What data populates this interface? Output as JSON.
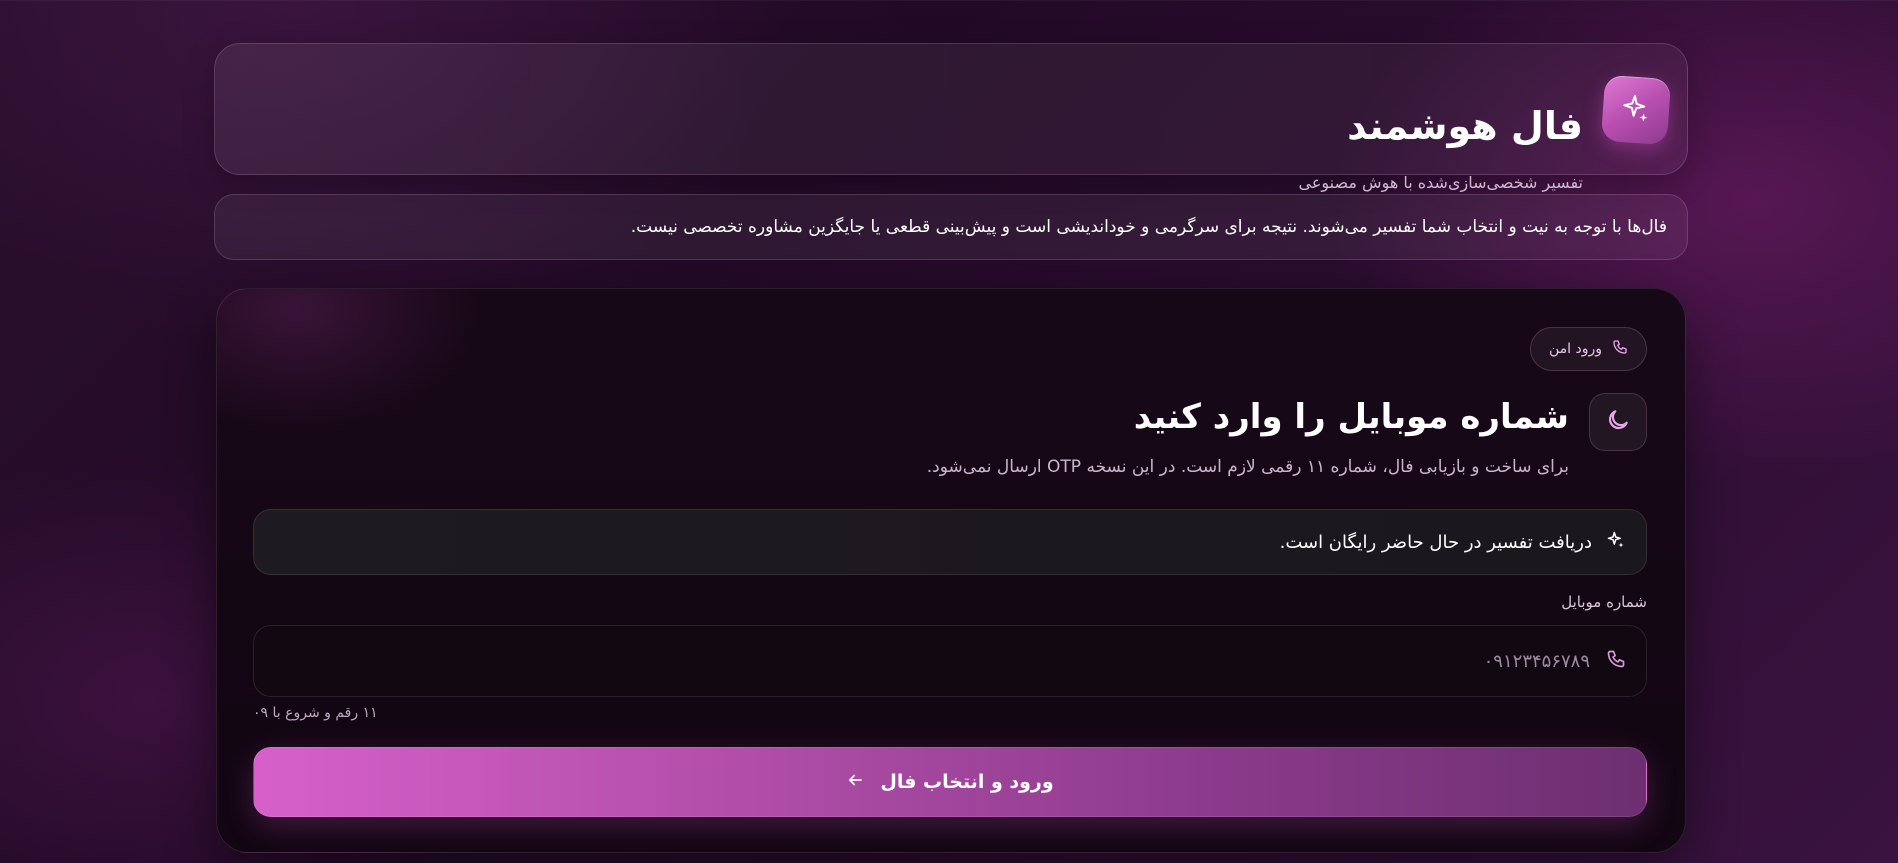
{
  "header": {
    "title": "فال هوشمند",
    "subtitle": "تفسیر شخصی‌سازی‌شده با هوش مصنوعی",
    "logo_icon": "sparkle-icon"
  },
  "notice": {
    "text": "فال‌ها با توجه به نیت و انتخاب شما تفسیر می‌شوند. نتیجه برای سرگرمی و خوداندیشی است و پیش‌بینی قطعی یا جایگزین مشاوره تخصصی نیست."
  },
  "login": {
    "badge_label": "ورود امن",
    "badge_icon": "phone-icon",
    "title_icon": "moon-icon",
    "title": "شماره موبایل را وارد کنید",
    "description": "برای ساخت و بازیابی فال، شماره ۱۱ رقمی لازم است. در این نسخه OTP ارسال نمی‌شود.",
    "free_banner": "دریافت تفسیر در حال حاضر رایگان است.",
    "free_banner_icon": "sparkle-icon",
    "field_label": "شماره موبایل",
    "field_placeholder": "۰۹۱۲۳۴۵۶۷۸۹",
    "field_value": "",
    "field_icon": "phone-icon",
    "field_hint": "۱۱ رقم و شروع با ۰۹",
    "submit_label": "ورود و انتخاب فال",
    "submit_icon": "arrow-left-icon"
  },
  "colors": {
    "accent": "#d660c9",
    "accent_dark": "#6d2f70",
    "background": "#2a0f2c",
    "card": "#130713"
  }
}
